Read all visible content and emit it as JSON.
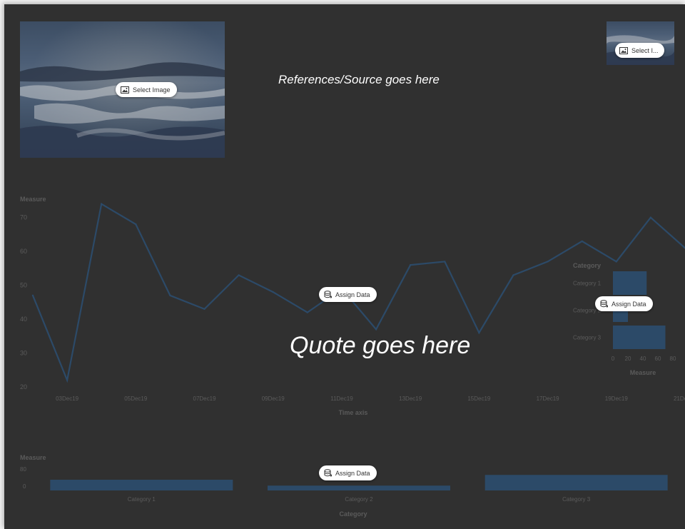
{
  "image_large": {
    "button_label": "Select Image"
  },
  "image_small": {
    "button_label": "Select I..."
  },
  "references_text": "References/Source goes here",
  "quote_text": "Quote goes here",
  "assign_data_label": "Assign Data",
  "chart_data": [
    {
      "type": "line",
      "ylabel": "Measure",
      "xlabel": "Time axis",
      "ylim": [
        20,
        75
      ],
      "yticks": [
        20,
        30,
        40,
        50,
        60,
        70
      ],
      "x_tick_labels": [
        "03Dec19",
        "05Dec19",
        "07Dec19",
        "09Dec19",
        "11Dec19",
        "13Dec19",
        "15Dec19",
        "17Dec19",
        "19Dec19",
        "21Dec19"
      ],
      "x": [
        "02Dec19",
        "03Dec19",
        "04Dec19",
        "05Dec19",
        "06Dec19",
        "07Dec19",
        "08Dec19",
        "09Dec19",
        "10Dec19",
        "11Dec19",
        "12Dec19",
        "13Dec19",
        "14Dec19",
        "15Dec19",
        "16Dec19",
        "17Dec19",
        "18Dec19",
        "19Dec19",
        "20Dec19",
        "21Dec19"
      ],
      "values": [
        47,
        22,
        74,
        68,
        47,
        43,
        53,
        48,
        42,
        49,
        37,
        56,
        57,
        36,
        53,
        57,
        63,
        57,
        70,
        61
      ],
      "color": "#2c4a68",
      "grid": false
    },
    {
      "type": "bar",
      "orientation": "horizontal",
      "legend_title": "Category",
      "categories": [
        "Category 1",
        "Category 2",
        "Category 3"
      ],
      "values": [
        45,
        20,
        70
      ],
      "xlabel": "Measure",
      "xticks": [
        0,
        20,
        40,
        60,
        80
      ],
      "xlim": [
        0,
        80
      ],
      "color": "#2c4a68"
    },
    {
      "type": "bar",
      "categories": [
        "Category 1",
        "Category 2",
        "Category 3"
      ],
      "values": [
        40,
        18,
        58
      ],
      "ylabel": "Measure",
      "xlabel": "Category",
      "yticks": [
        0,
        80
      ],
      "ylim": [
        0,
        80
      ],
      "color": "#2c4a68"
    }
  ]
}
